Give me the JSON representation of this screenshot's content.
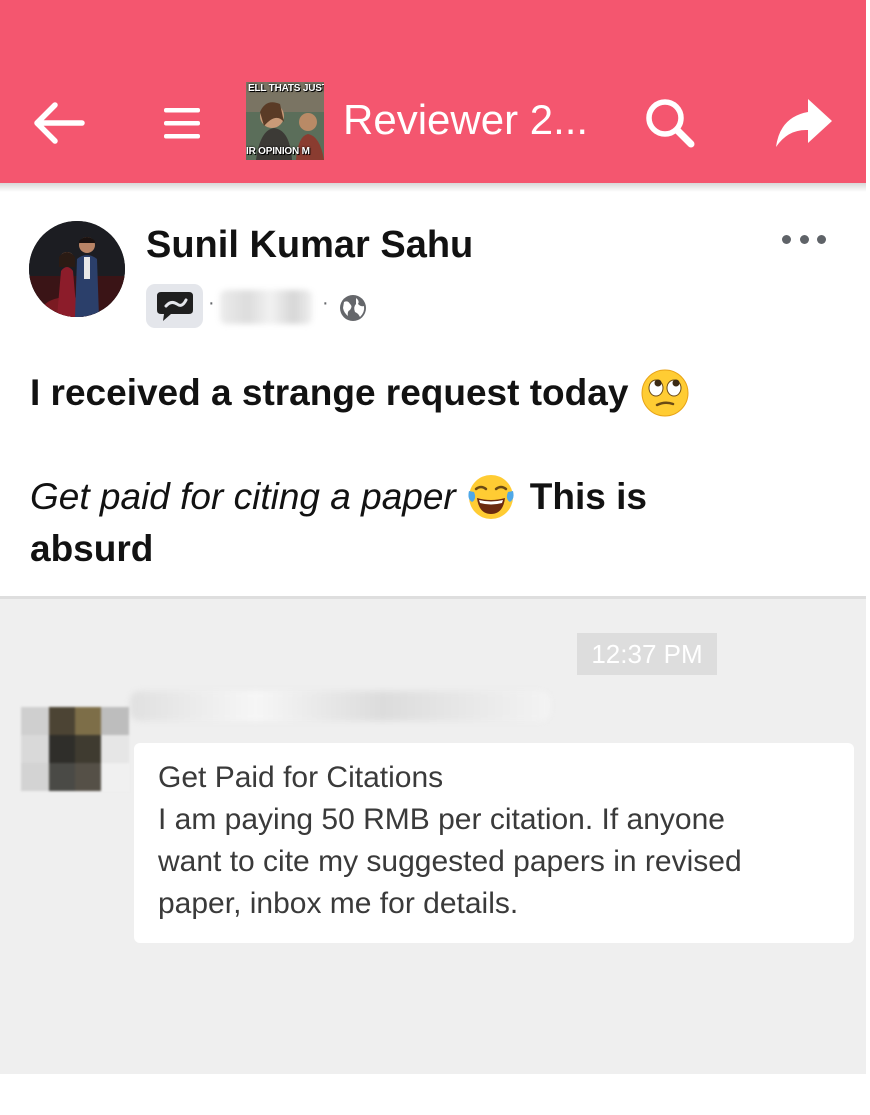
{
  "header": {
    "background_color": "#f4566f",
    "group_title": "Reviewer 2...",
    "thumbnail_caption_top": "ELL THATS JUST L",
    "thumbnail_caption_bottom": "IR OPINION M",
    "icons": [
      "back-arrow-icon",
      "menu-icon",
      "search-icon",
      "share-icon"
    ]
  },
  "post": {
    "author": "Sunil Kumar Sahu",
    "meta_separator": "·",
    "line1": "I received a strange request today",
    "line1_emoji": "face-with-rolling-eyes",
    "line2_italic": "Get paid for citing a paper",
    "line2_emoji": "face-with-tears-of-joy",
    "line2_bold": "This is",
    "line3": "absurd"
  },
  "screenshot": {
    "timestamp": "12:37 PM",
    "message_title": "Get Paid for Citations",
    "message_lines": [
      "I am paying 50 RMB per citation. If anyone",
      "want to cite my suggested papers in revised",
      "paper, inbox me for details."
    ]
  }
}
